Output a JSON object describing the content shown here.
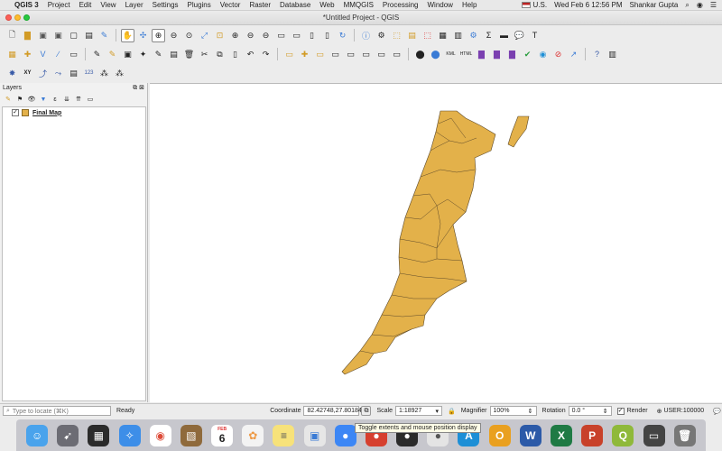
{
  "menubar": {
    "app_name": "QGIS 3",
    "items": [
      "Project",
      "Edit",
      "View",
      "Layer",
      "Settings",
      "Plugins",
      "Vector",
      "Raster",
      "Database",
      "Web",
      "MMQGIS",
      "Processing",
      "Window",
      "Help"
    ],
    "input_source": "U.S.",
    "datetime": "Wed Feb 6  12:56 PM",
    "user": "Shankar Gupta"
  },
  "window": {
    "title": "*Untitled Project - QGIS"
  },
  "layers_panel": {
    "title": "Layers",
    "layers": [
      {
        "name": "Final Map",
        "checked": true,
        "color": "#e3b14a"
      }
    ]
  },
  "map": {
    "feature_fill": "#e3b14a",
    "feature_stroke": "#5e4a2a"
  },
  "statusbar": {
    "locate_placeholder": "Type to locate (⌘K)",
    "ready": "Ready",
    "coordinate_label": "Coordinate",
    "coordinate_value": "82.42748,27.80184",
    "scale_label": "Scale",
    "scale_value": "1:18927",
    "magnifier_label": "Magnifier",
    "magnifier_value": "100%",
    "rotation_label": "Rotation",
    "rotation_value": "0.0 °",
    "render_label": "Render",
    "crs": "USER:100000"
  },
  "tooltip": "Toggle extents and mouse position display",
  "dock": {
    "calendar_month": "FEB",
    "calendar_day": "6"
  }
}
